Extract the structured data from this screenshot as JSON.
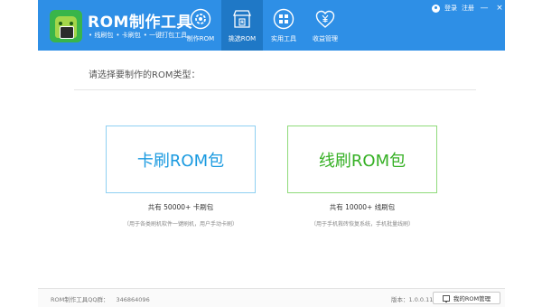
{
  "app": {
    "title": "ROM制作工具",
    "features": [
      "• 线刷包",
      "• 卡刷包",
      "• 一键打包工具"
    ]
  },
  "nav": {
    "items": [
      {
        "label": "制作ROM",
        "icon": "gear-icon"
      },
      {
        "label": "挑选ROM",
        "icon": "store-icon",
        "active": true
      },
      {
        "label": "实用工具",
        "icon": "grid-icon"
      },
      {
        "label": "收益管理",
        "icon": "yen-heart-icon"
      }
    ]
  },
  "topbar": {
    "login": "登录",
    "register": "注册",
    "minimize": "—",
    "close": "×"
  },
  "main": {
    "prompt": "请选择要制作的ROM类型：",
    "options": [
      {
        "label": "卡刷ROM包",
        "count": "共有 50000+ 卡刷包",
        "desc": "（用于各类刷机软件一键刷机，用户手动卡刷）"
      },
      {
        "label": "线刷ROM包",
        "count": "共有 10000+ 线刷包",
        "desc": "（用于手机救砖恢复系统，手机批量线刷）"
      }
    ]
  },
  "footer": {
    "qq_label": "ROM制作工具QQ群：",
    "qq_number": "346864096",
    "version": "版本：1.0.0.11",
    "my_rom": "我的ROM管理"
  },
  "colors": {
    "header": "#2e8fe6",
    "active_tab": "#1f78c6",
    "card_blue": "#1a9ae0",
    "card_green": "#35b024"
  }
}
